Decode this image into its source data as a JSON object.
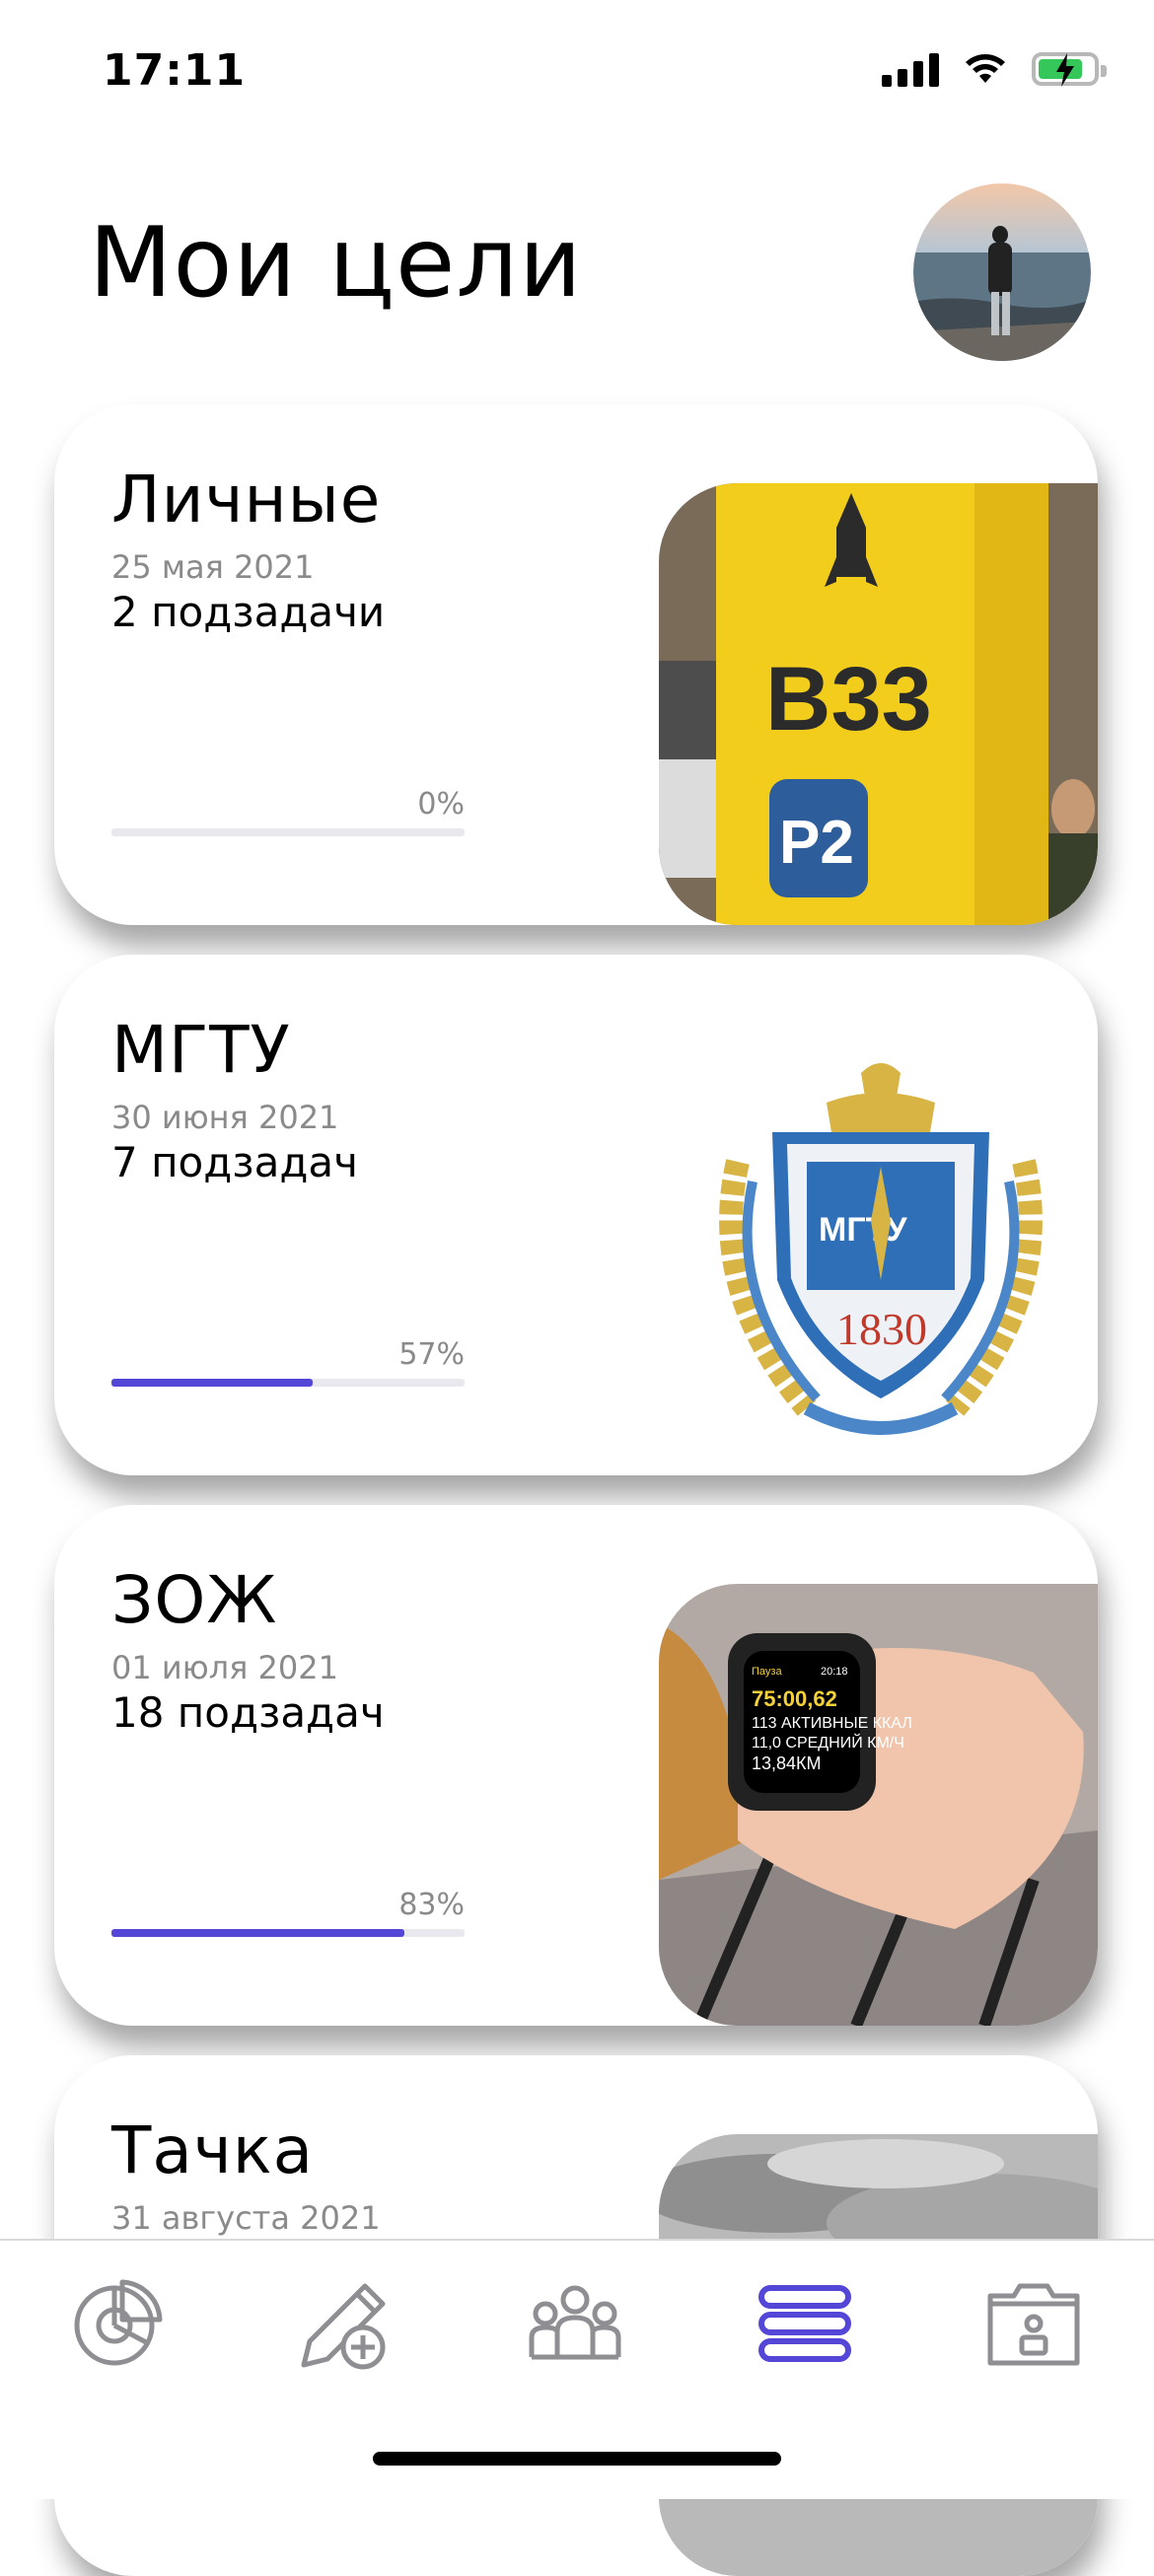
{
  "status_bar": {
    "time": "17:11"
  },
  "header": {
    "title": "Мои цели"
  },
  "goals": [
    {
      "title": "Личные",
      "date": "25 мая 2021",
      "subtasks": "2 подзадачи",
      "progress_label": "0%",
      "progress": 0
    },
    {
      "title": "МГТУ",
      "date": "30 июня 2021",
      "subtasks": "7 подзадач",
      "progress_label": "57%",
      "progress": 0.57
    },
    {
      "title": "ЗОЖ",
      "date": "01 июля 2021",
      "subtasks": "18 подзадач",
      "progress_label": "83%",
      "progress": 0.83
    },
    {
      "title": "Тачка",
      "date": "31 августа 2021"
    }
  ],
  "images": {
    "parking_text": "B33",
    "parking_badge": "P2",
    "emblem_year": "1830",
    "emblem_text": "МГТУ",
    "watch_pause": "Пауза",
    "watch_clock": "20:18",
    "watch_lines": [
      "75:00,62",
      "113 АКТИВНЫЕ ККАЛ",
      "11,0 СРЕДНИЙ КМ/Ч",
      "13,84КМ"
    ]
  },
  "tabs": [
    {
      "icon": "pie-chart-icon"
    },
    {
      "icon": "edit-add-icon"
    },
    {
      "icon": "people-icon"
    },
    {
      "icon": "list-icon"
    },
    {
      "icon": "profile-folder-icon"
    }
  ],
  "colors": {
    "accent": "#5446d6",
    "track": "#e9e8ef",
    "icon_inactive": "#8e8e93"
  }
}
